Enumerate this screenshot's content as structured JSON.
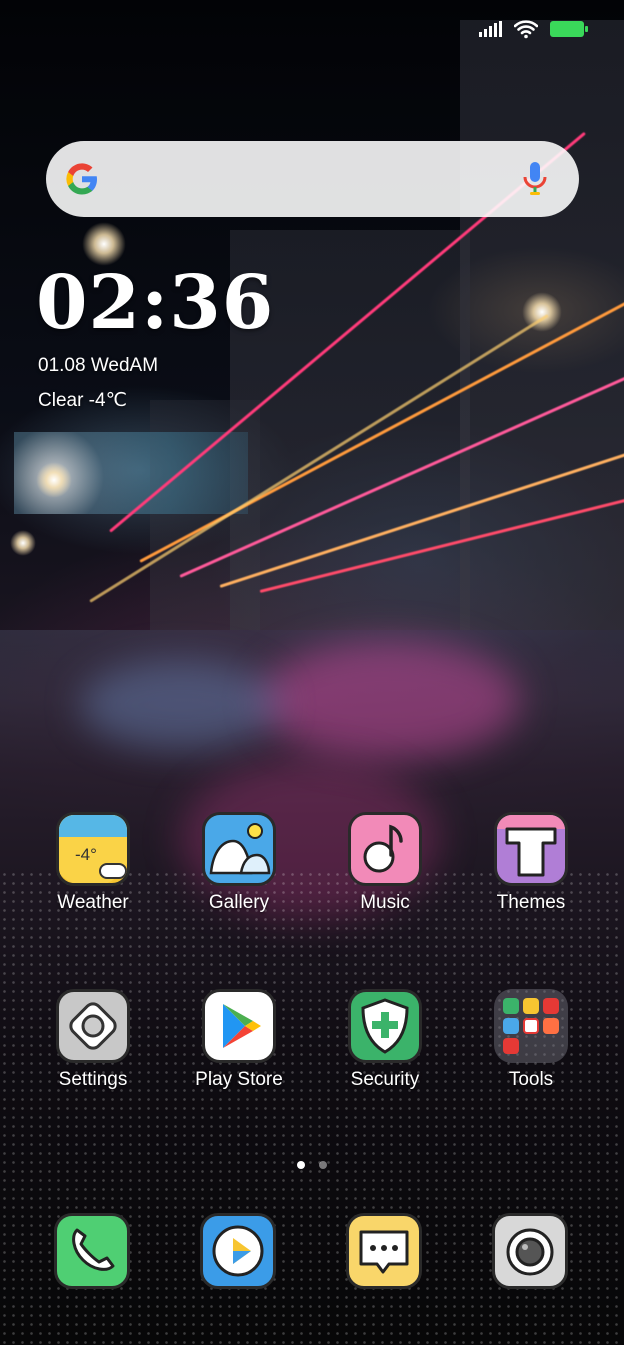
{
  "status_bar": {
    "signal_icon": "cellular-signal-icon",
    "wifi_icon": "wifi-icon",
    "battery_icon": "battery-full-icon",
    "battery_color": "#3ad85a"
  },
  "search_bar": {
    "google_icon": "google-g-icon",
    "mic_icon": "microphone-icon"
  },
  "clock_widget": {
    "time": "02:36",
    "date": "01.08 WedAM",
    "weather": "Clear -4℃"
  },
  "apps": [
    {
      "label": "Weather",
      "icon": "weather-icon",
      "badge": "-4°"
    },
    {
      "label": "Gallery",
      "icon": "gallery-icon"
    },
    {
      "label": "Music",
      "icon": "music-icon"
    },
    {
      "label": "Themes",
      "icon": "themes-icon"
    },
    {
      "label": "Settings",
      "icon": "settings-icon"
    },
    {
      "label": "Play Store",
      "icon": "play-store-icon"
    },
    {
      "label": "Security",
      "icon": "security-icon"
    },
    {
      "label": "Tools",
      "icon": "tools-folder-icon"
    }
  ],
  "page_indicator": {
    "pages": 2,
    "current": 1
  },
  "dock": [
    {
      "icon": "phone-icon"
    },
    {
      "icon": "browser-icon"
    },
    {
      "icon": "messages-icon"
    },
    {
      "icon": "camera-icon"
    }
  ],
  "colors": {
    "weather_bg": "#f7c531",
    "gallery_bg": "#4aa8e8",
    "music_bg": "#f28ab8",
    "themes_bg": "#b07ed6",
    "settings_bg": "#c8c8c8",
    "playstore_bg": "#ffffff",
    "security_bg": "#3bb36a",
    "phone_bg": "#4fcf73",
    "browser_bg": "#3b9ce8",
    "messages_bg": "#f9d66a",
    "camera_bg": "#d8d8d8"
  }
}
